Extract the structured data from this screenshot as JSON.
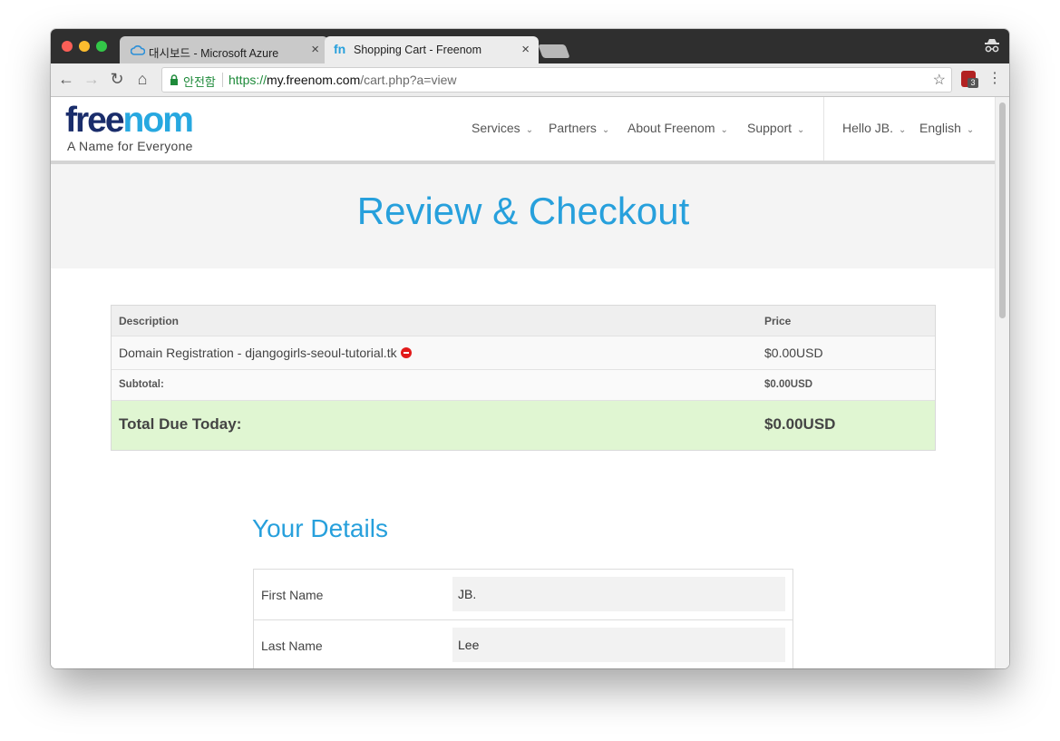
{
  "browser": {
    "tabs": [
      {
        "title": "대시보드 - Microsoft Azure",
        "close": "×"
      },
      {
        "title": "Shopping Cart - Freenom",
        "close": "×"
      }
    ],
    "security_label": "안전함",
    "url_scheme": "https://",
    "url_host": "my.freenom.com",
    "url_path": "/cart.php?a=view",
    "extension_badge": "3"
  },
  "site": {
    "logo_part1": "free",
    "logo_part2": "nom",
    "tagline": "A Name for Everyone",
    "nav": [
      "Services",
      "Partners",
      "About Freenom",
      "Support"
    ],
    "user_greeting": "Hello JB.",
    "language": "English"
  },
  "hero": {
    "title": "Review & Checkout"
  },
  "cart": {
    "headers": {
      "description": "Description",
      "price": "Price"
    },
    "item": {
      "description": "Domain Registration - djangogirls-seoul-tutorial.tk",
      "price": "$0.00USD"
    },
    "subtotal": {
      "label": "Subtotal:",
      "value": "$0.00USD"
    },
    "total": {
      "label": "Total Due Today:",
      "value": "$0.00USD"
    }
  },
  "details": {
    "title": "Your Details",
    "fields": [
      {
        "label": "First Name",
        "value": "JB."
      },
      {
        "label": "Last Name",
        "value": "Lee"
      }
    ]
  }
}
